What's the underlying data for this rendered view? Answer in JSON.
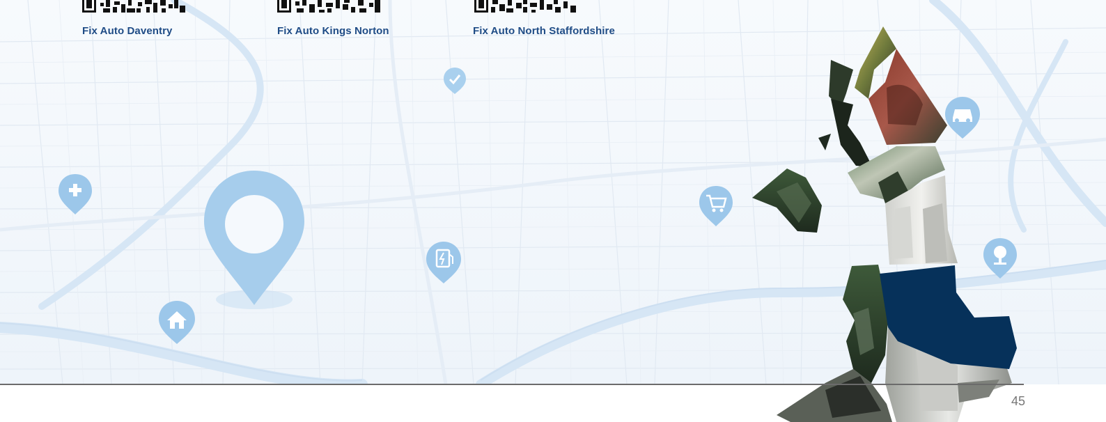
{
  "locations": [
    {
      "name": "Fix Auto Daventry"
    },
    {
      "name": "Fix Auto Kings Norton"
    },
    {
      "name": "Fix Auto North Staffordshire"
    }
  ],
  "page_number": "45",
  "icons": {
    "large_pin": "location-pin-icon",
    "small_pins": [
      "add-pin-icon",
      "home-pin-icon",
      "fuel-charge-pin-icon",
      "shopping-cart-pin-icon",
      "car-pin-icon",
      "tree-pin-icon",
      "check-pin-icon"
    ]
  },
  "colors": {
    "label_blue": "#1f4c86",
    "region_navy": "#06315a",
    "pin_blue": "#8fc1e6",
    "road": "#dbe6f1",
    "river": "#d7e8f6"
  }
}
